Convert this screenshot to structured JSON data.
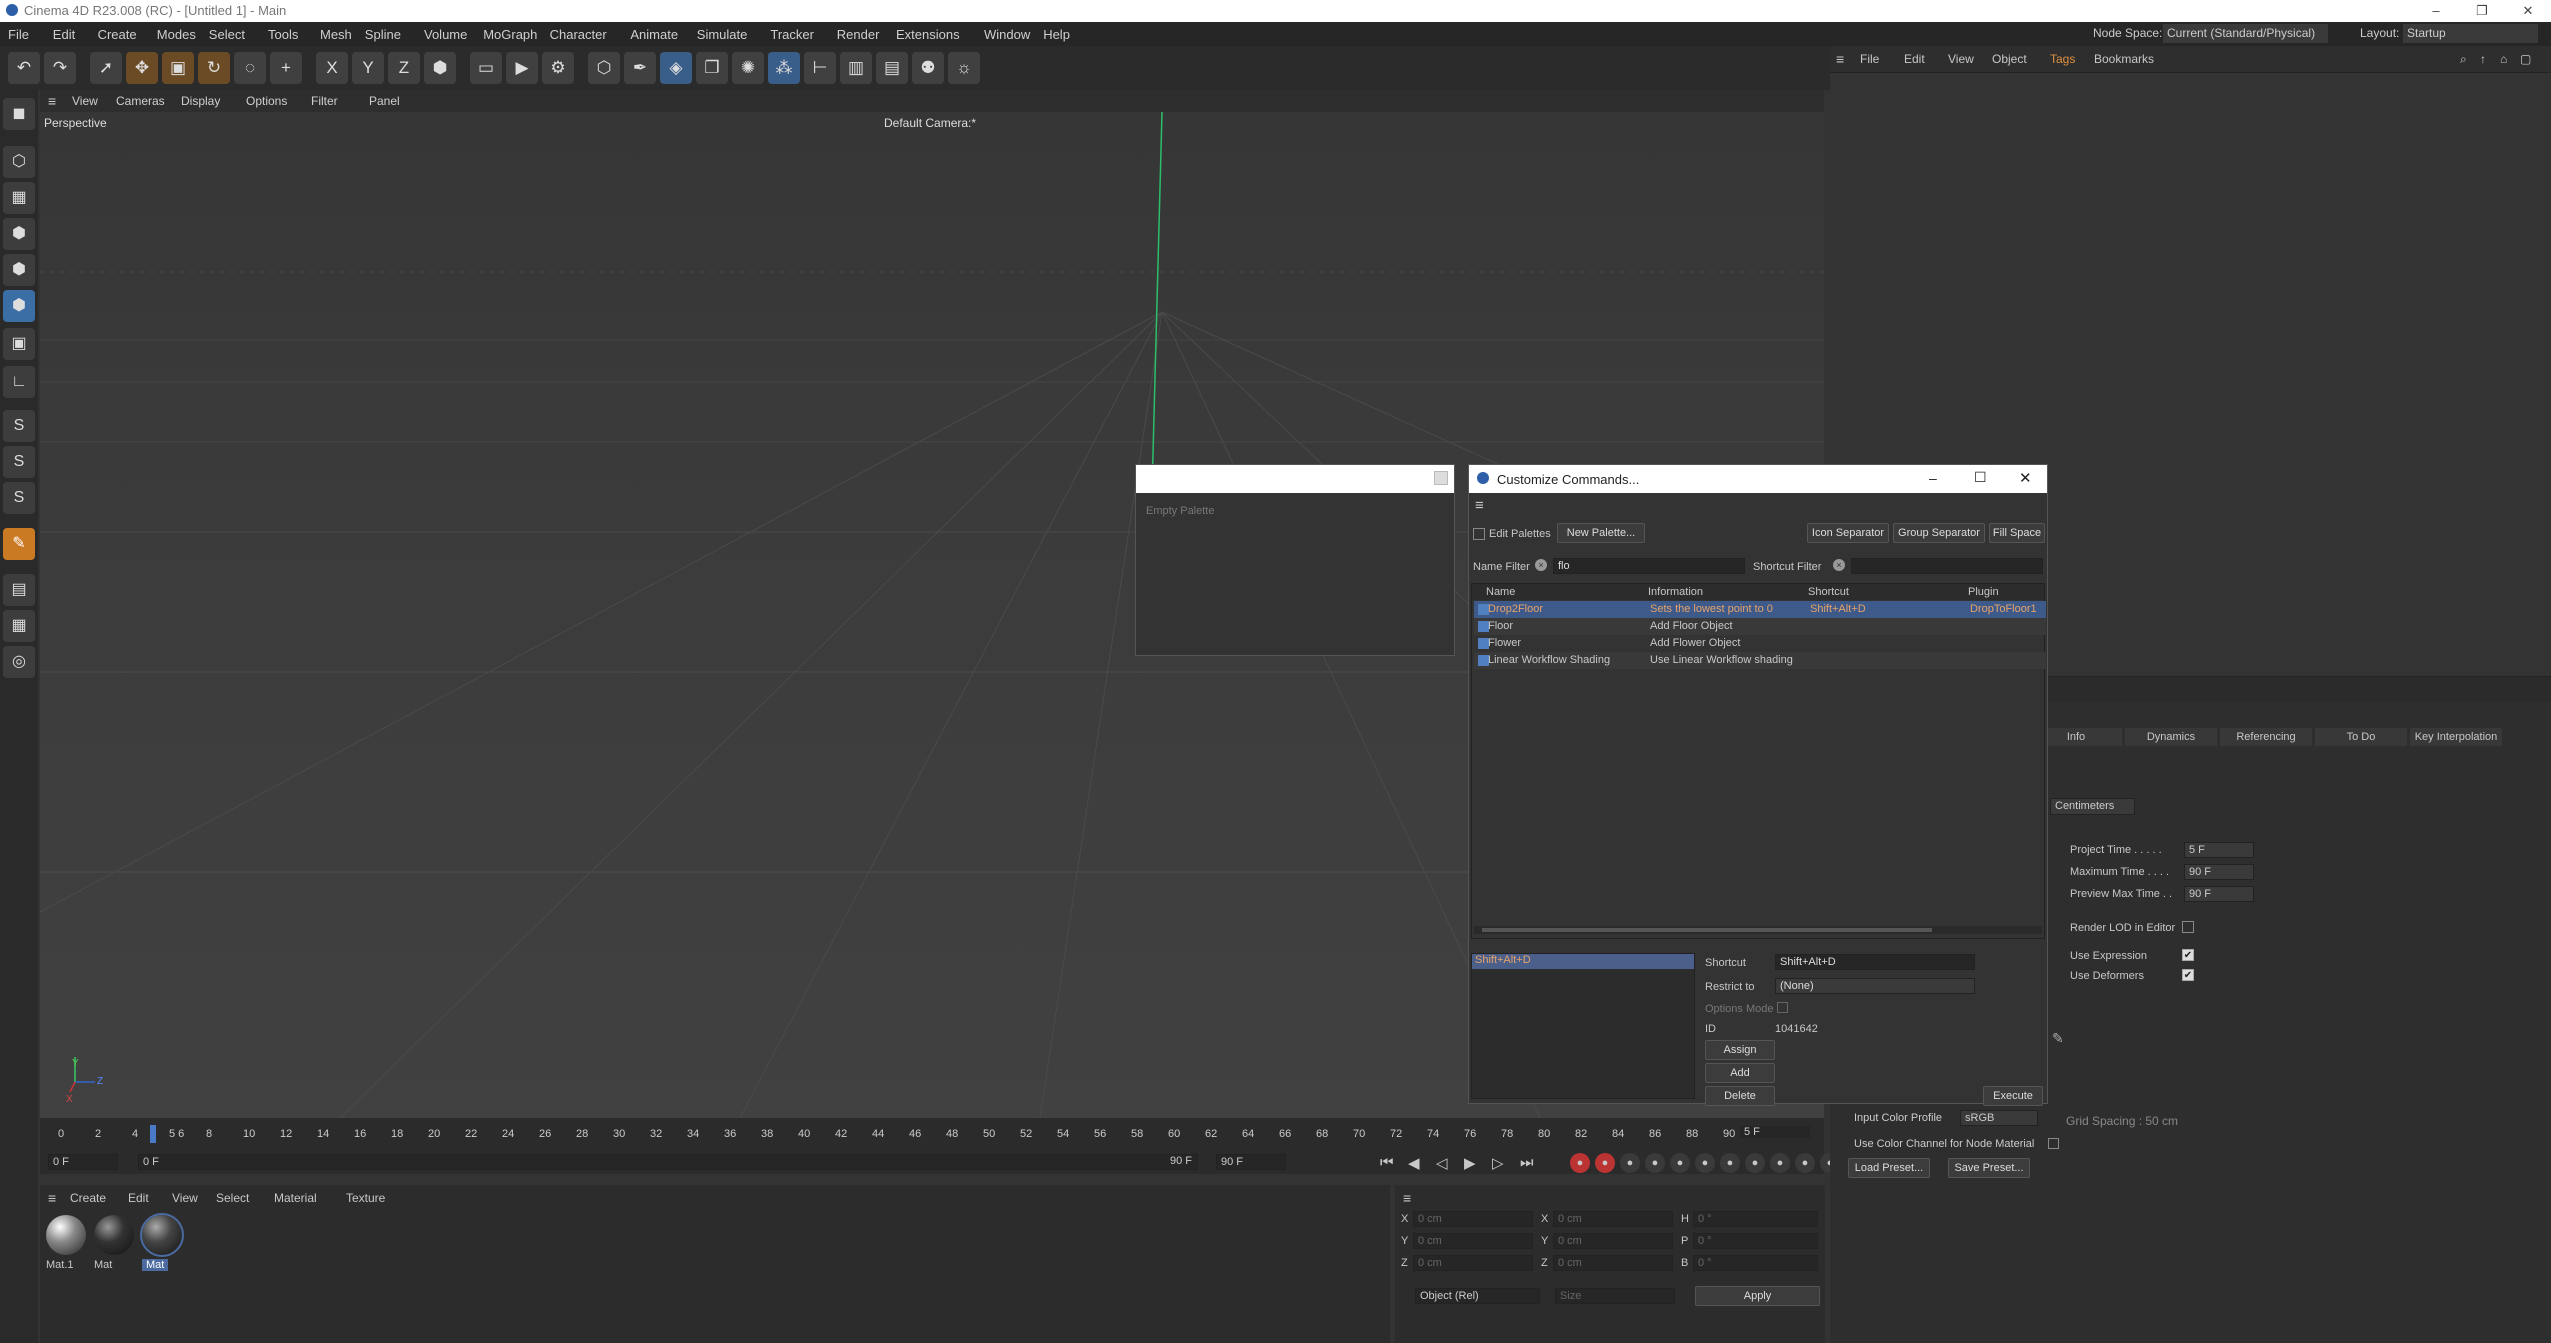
{
  "app": {
    "title": "Cinema 4D R23.008 (RC) - [Untitled 1] - Main",
    "minimize": "–",
    "restore": "❐",
    "close": "✕"
  },
  "menu": [
    "File",
    "Edit",
    "Create",
    "Modes",
    "Select",
    "Tools",
    "Mesh",
    "Spline",
    "Volume",
    "MoGraph",
    "Character",
    "Animate",
    "Simulate",
    "Tracker",
    "Render",
    "Extensions",
    "Window",
    "Help"
  ],
  "node_space": {
    "label": "Node Space:",
    "value": "Current (Standard/Physical)"
  },
  "layout": {
    "label": "Layout:",
    "value": "Startup"
  },
  "toolbar_icons": [
    "undo-icon",
    "redo-icon",
    "select-icon",
    "move-icon",
    "scale-icon",
    "rotate-icon",
    "recent-icon",
    "plus-icon",
    "x-axis-icon",
    "y-axis-icon",
    "z-axis-icon",
    "coord-system-icon",
    "render-region-icon",
    "render-view-icon",
    "render-settings-icon",
    "cube-icon",
    "pen-icon",
    "subdivision-icon",
    "extrude-icon",
    "cloner-icon",
    "array-icon",
    "deformer-icon",
    "camera-icon",
    "floor-icon",
    "scene-icon",
    "light-icon"
  ],
  "toolbar_glyphs": {
    "x": "X",
    "y": "Y",
    "z": "Z"
  },
  "viewport": {
    "menu": [
      "View",
      "Cameras",
      "Display",
      "Options",
      "Filter",
      "Panel"
    ],
    "label": "Perspective",
    "camera": "Default Camera:*",
    "axis_y": "Y",
    "axis_z": "Z",
    "axis_x": "X"
  },
  "timeline": {
    "ticks": [
      "0",
      "2",
      "4",
      "5 6",
      "8",
      "10",
      "12",
      "14",
      "16",
      "18",
      "20",
      "22",
      "24",
      "26",
      "28",
      "30",
      "32",
      "34",
      "36",
      "38",
      "40",
      "42",
      "44",
      "46",
      "48",
      "50",
      "52",
      "54",
      "56",
      "58",
      "60",
      "62",
      "64",
      "66",
      "68",
      "70",
      "72",
      "74",
      "76",
      "78",
      "80",
      "82",
      "84",
      "86",
      "88",
      "90"
    ],
    "current_frame": "5 F",
    "start": "0 F",
    "start2": "0 F",
    "end": "90 F",
    "end2": "90 F"
  },
  "materials": {
    "menu": [
      "Create",
      "Edit",
      "View",
      "Select",
      "Material",
      "Texture"
    ],
    "items": [
      "Mat.1",
      "Mat",
      "Mat"
    ]
  },
  "coords": {
    "rows": [
      {
        "a": "X",
        "v1": "0 cm",
        "b": "X",
        "v2": "0 cm",
        "c": "H",
        "v3": "0 °"
      },
      {
        "a": "Y",
        "v1": "0 cm",
        "b": "Y",
        "v2": "0 cm",
        "c": "P",
        "v3": "0 °"
      },
      {
        "a": "Z",
        "v1": "0 cm",
        "b": "Z",
        "v2": "0 cm",
        "c": "B",
        "v3": "0 °"
      }
    ],
    "mode": "Object (Rel)",
    "size": "Size",
    "apply": "Apply"
  },
  "object_manager": {
    "menu": [
      "File",
      "Edit",
      "View",
      "Object",
      "Tags",
      "Bookmarks"
    ]
  },
  "attributes": {
    "tabs": [
      "Info",
      "Dynamics",
      "Referencing",
      "To Do",
      "Key Interpolation"
    ],
    "units": "Centimeters",
    "fields": [
      {
        "label": "Project Time . . . . .",
        "value": "5 F"
      },
      {
        "label": "Maximum Time . . . .",
        "value": "90 F"
      },
      {
        "label": "Preview Max Time . .",
        "value": "90 F"
      }
    ],
    "render_lod": "Render LOD in Editor",
    "use_expression": "Use Expression",
    "use_deformers": "Use Deformers",
    "input_color_profile": "Input Color Profile",
    "profile_value": "sRGB",
    "use_color_channel": "Use Color Channel for Node Material",
    "load_preset": "Load Preset...",
    "save_preset": "Save Preset...",
    "grid_spacing": "Grid Spacing : 50 cm"
  },
  "palette": {
    "empty": "Empty Palette"
  },
  "dialog": {
    "title": "Customize Commands...",
    "edit_palettes": "Edit Palettes",
    "new_palette": "New Palette...",
    "icon_separator": "Icon Separator",
    "group_separator": "Group Separator",
    "fill_space": "Fill Space",
    "name_filter": "Name Filter",
    "name_value": "flo",
    "shortcut_filter": "Shortcut Filter",
    "columns": [
      "Name",
      "Information",
      "Shortcut",
      "Plugin"
    ],
    "rows": [
      {
        "name": "Drop2Floor",
        "info": "Sets the lowest point to 0",
        "shortcut": "Shift+Alt+D",
        "plugin": "DropToFloor1"
      },
      {
        "name": "Floor",
        "info": "Add Floor Object",
        "shortcut": "",
        "plugin": ""
      },
      {
        "name": "Flower",
        "info": "Add Flower Object",
        "shortcut": "",
        "plugin": ""
      },
      {
        "name": "Linear Workflow Shading",
        "info": "Use Linear Workflow shading",
        "shortcut": "",
        "plugin": ""
      }
    ],
    "selected_shortcut": "Shift+Alt+D",
    "shortcut_label": "Shortcut",
    "shortcut_value": "Shift+Alt+D",
    "restrict_label": "Restrict to",
    "restrict_value": "(None)",
    "options_mode": "Options Mode",
    "id_label": "ID",
    "id_value": "1041642",
    "assign": "Assign",
    "add": "Add",
    "delete": "Delete",
    "execute": "Execute"
  },
  "colors": {
    "accent": "#cb7a24",
    "selection": "#3d5a8a",
    "bg": "#333333"
  }
}
